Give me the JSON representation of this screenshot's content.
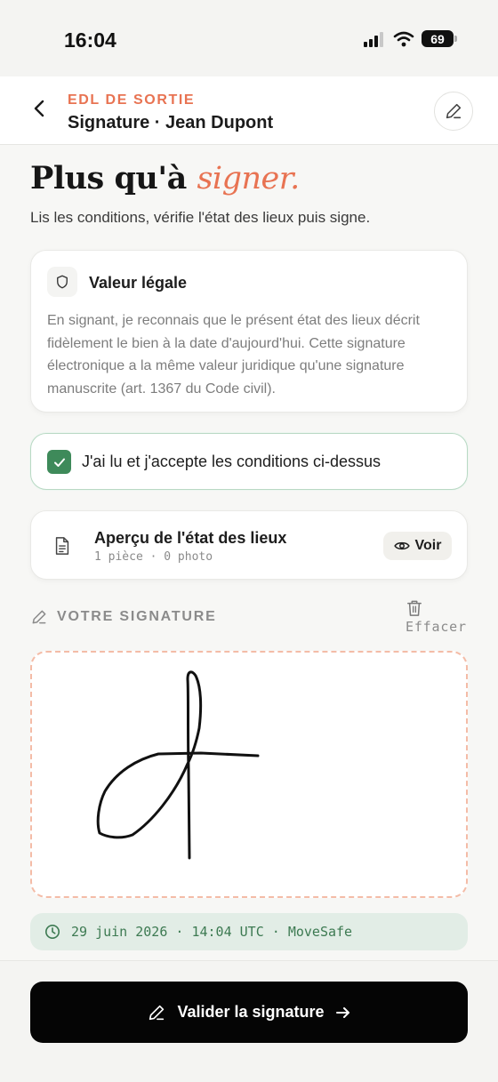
{
  "status_bar": {
    "time": "16:04",
    "battery": "69"
  },
  "header": {
    "eyebrow": "EDL DE SORTIE",
    "title": "Signature · Jean Dupont"
  },
  "hero": {
    "title_prefix": "Plus qu'à ",
    "title_accent": "signer.",
    "subtitle": "Lis les conditions, vérifie l'état des lieux puis signe."
  },
  "legal": {
    "title": "Valeur légale",
    "text": "En signant, je reconnais que le présent état des lieux décrit fidèlement le bien à la date d'aujourd'hui. Cette signature électronique a la même valeur juridique qu'une signature manuscrite (art. 1367 du Code civil)."
  },
  "acceptance": {
    "label": "J'ai lu et j'accepte les conditions ci-dessus",
    "checked": true
  },
  "preview": {
    "title": "Aperçu de l'état des lieux",
    "meta": "1 pièce · 0 photo",
    "button": "Voir"
  },
  "signature": {
    "section_label": "VOTRE SIGNATURE",
    "clear_label": "Effacer"
  },
  "timestamp": {
    "text": "29 juin 2026 · 14:04 UTC · MoveSafe"
  },
  "footer": {
    "validate_label": "Valider la signature"
  },
  "colors": {
    "accent": "#e87352",
    "success": "#3e8a5a",
    "primary_button": "#050505"
  },
  "icons": {
    "back": "chevron-left-icon",
    "edit": "pencil-icon",
    "legal": "shield-icon",
    "check": "check-icon",
    "document": "document-icon",
    "eye": "eye-icon",
    "trash": "trash-icon",
    "clock": "clock-icon",
    "arrow": "arrow-right-icon"
  }
}
